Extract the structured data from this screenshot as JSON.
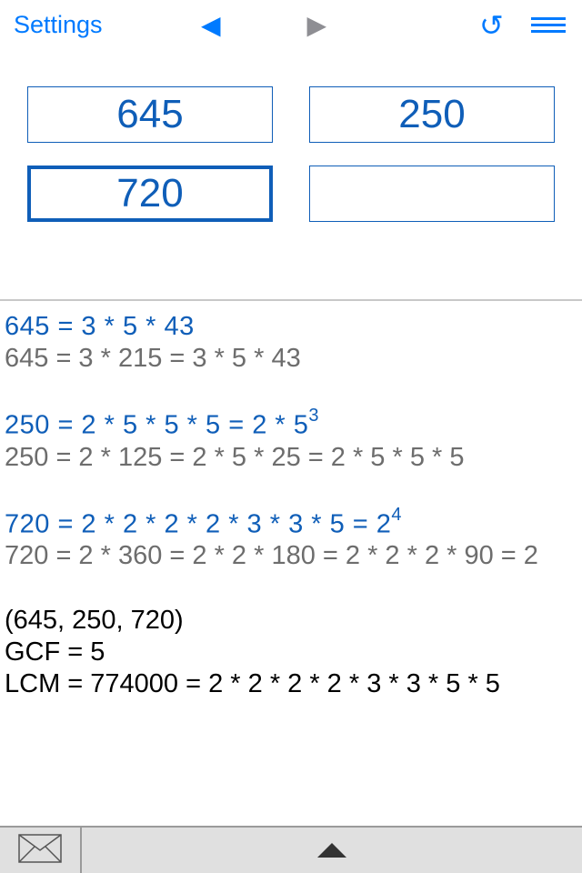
{
  "header": {
    "settings_label": "Settings"
  },
  "inputs": {
    "n1": "645",
    "n2": "250",
    "n3": "720",
    "n4": ""
  },
  "results": {
    "line1_blue": "645 = 3  *  5  *  43",
    "line1_gray": "645 = 3 * 215 = 3 * 5 * 43",
    "line2_blue_base": "250 = 2  *  5  *  5  *  5 = 2  *  5",
    "line2_blue_sup": "3",
    "line2_gray": "250 = 2 * 125 = 2 * 5 * 25 = 2 * 5 * 5 * 5",
    "line3_blue_base": "720 = 2  *  2  *  2  *  2  *  3  *  3  *  5 = 2",
    "line3_blue_sup": "4",
    "line3_gray": "720 = 2 * 360 = 2 * 2 * 180 = 2 * 2 * 2 * 90 = 2",
    "summary_tuple": "(645, 250, 720)",
    "gcf": "GCF = 5",
    "lcm": "LCM = 774000 = 2 * 2 * 2 * 2 * 3 * 3 * 5 * 5"
  },
  "colors": {
    "accent": "#007aff",
    "input_border": "#0f5eb8",
    "gray_text": "#6d6d6d"
  }
}
